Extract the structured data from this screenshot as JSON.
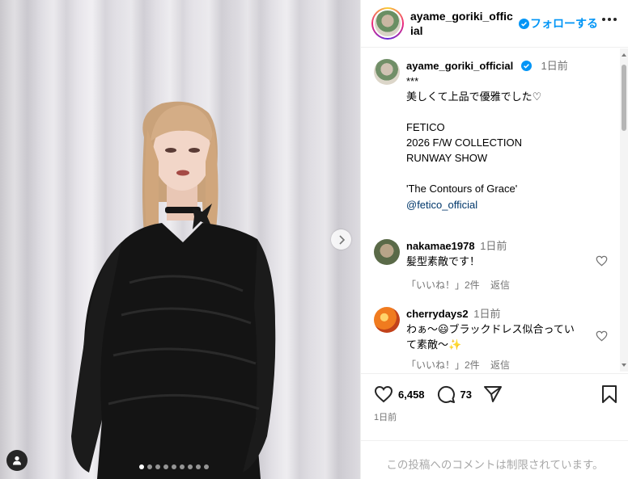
{
  "post": {
    "media_dots": 9,
    "active_dot": 0
  },
  "header": {
    "username": "ayame_goriki_official",
    "follow_label": "フォローする"
  },
  "caption": {
    "username": "ayame_goriki_official",
    "time": "1日前",
    "text": "***\n美しくて上品で優雅でした♡\n\nFETICO\n2026 F/W COLLECTION\nRUNWAY SHOW\n\n'The Contours of Grace'\n\n",
    "mention": "@fetico_official"
  },
  "comments": [
    {
      "username": "nakamae1978",
      "time": "1日前",
      "text": "髪型素敵です！",
      "likes_label": "「いいね！」2件",
      "reply_label": "返信"
    },
    {
      "username": "cherrydays2",
      "time": "1日前",
      "text": "わぁ〜😃ブラックドレス似合っていて素敵〜✨",
      "likes_label": "「いいね！」2件",
      "reply_label": "返信"
    }
  ],
  "actions": {
    "like_count": "6,458",
    "comment_count": "73"
  },
  "post_time": "1日前",
  "comments_limited": "この投稿へのコメントは制限されています。"
}
